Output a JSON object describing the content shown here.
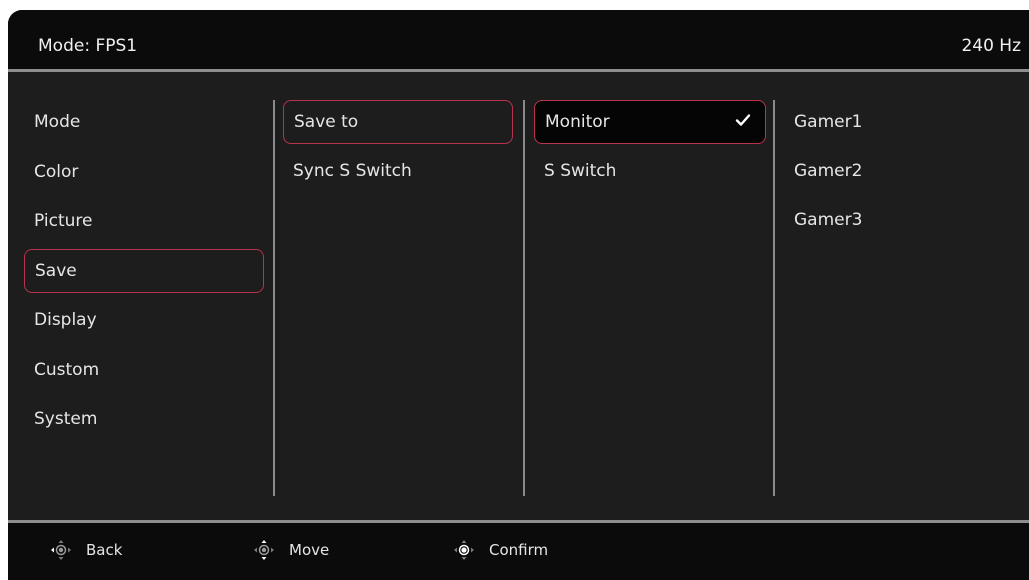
{
  "header": {
    "mode_text": "Mode: FPS1",
    "refresh_rate": "240 Hz"
  },
  "menu": {
    "items": [
      {
        "label": "Mode"
      },
      {
        "label": "Color"
      },
      {
        "label": "Picture"
      },
      {
        "label": "Save",
        "selected": true
      },
      {
        "label": "Display"
      },
      {
        "label": "Custom"
      },
      {
        "label": "System"
      }
    ]
  },
  "save_menu": {
    "items": [
      {
        "label": "Save to",
        "selected": true
      },
      {
        "label": "Sync S Switch"
      }
    ]
  },
  "save_to_options": {
    "items": [
      {
        "label": "Monitor",
        "selected": true,
        "checked": true
      },
      {
        "label": "S Switch"
      }
    ]
  },
  "slots": {
    "items": [
      {
        "label": "Gamer1"
      },
      {
        "label": "Gamer2"
      },
      {
        "label": "Gamer3"
      }
    ]
  },
  "footer": {
    "hints": [
      {
        "icon": "dpad-left-icon",
        "label": "Back"
      },
      {
        "icon": "dpad-updown-icon",
        "label": "Move"
      },
      {
        "icon": "dpad-center-icon",
        "label": "Confirm"
      }
    ]
  },
  "colors": {
    "accent": "#b8344d",
    "background": "#1d1d1d",
    "bar": "#0b0b0b",
    "divider": "#8e8e8e"
  }
}
